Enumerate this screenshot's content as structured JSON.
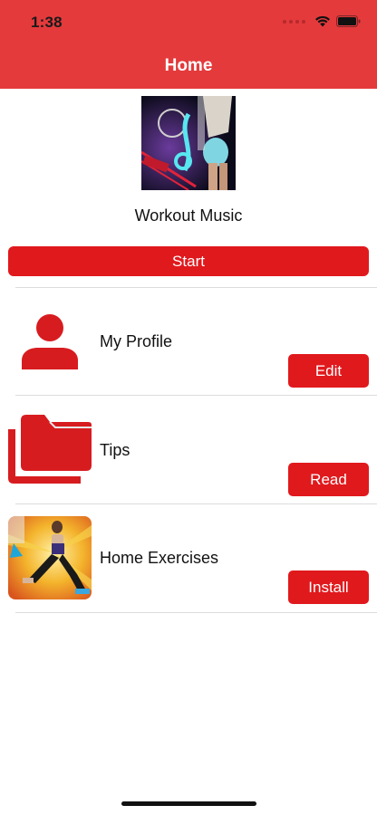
{
  "status_bar": {
    "time": "1:38",
    "signal_icon": "signal-dots-icon",
    "wifi_icon": "wifi-icon",
    "battery_icon": "battery-icon"
  },
  "nav": {
    "title": "Home"
  },
  "hero": {
    "title": "Workout Music",
    "start_label": "Start",
    "image": "workout-music-artwork"
  },
  "rows": [
    {
      "label": "My Profile",
      "button": "Edit",
      "icon": "person-icon"
    },
    {
      "label": "Tips",
      "button": "Read",
      "icon": "folder-icon"
    },
    {
      "label": "Home Exercises",
      "button": "Install",
      "icon": "home-exercises-app-icon"
    }
  ],
  "colors": {
    "header": "#e43a3c",
    "button": "#e0191d",
    "accent": "#d71c20"
  }
}
